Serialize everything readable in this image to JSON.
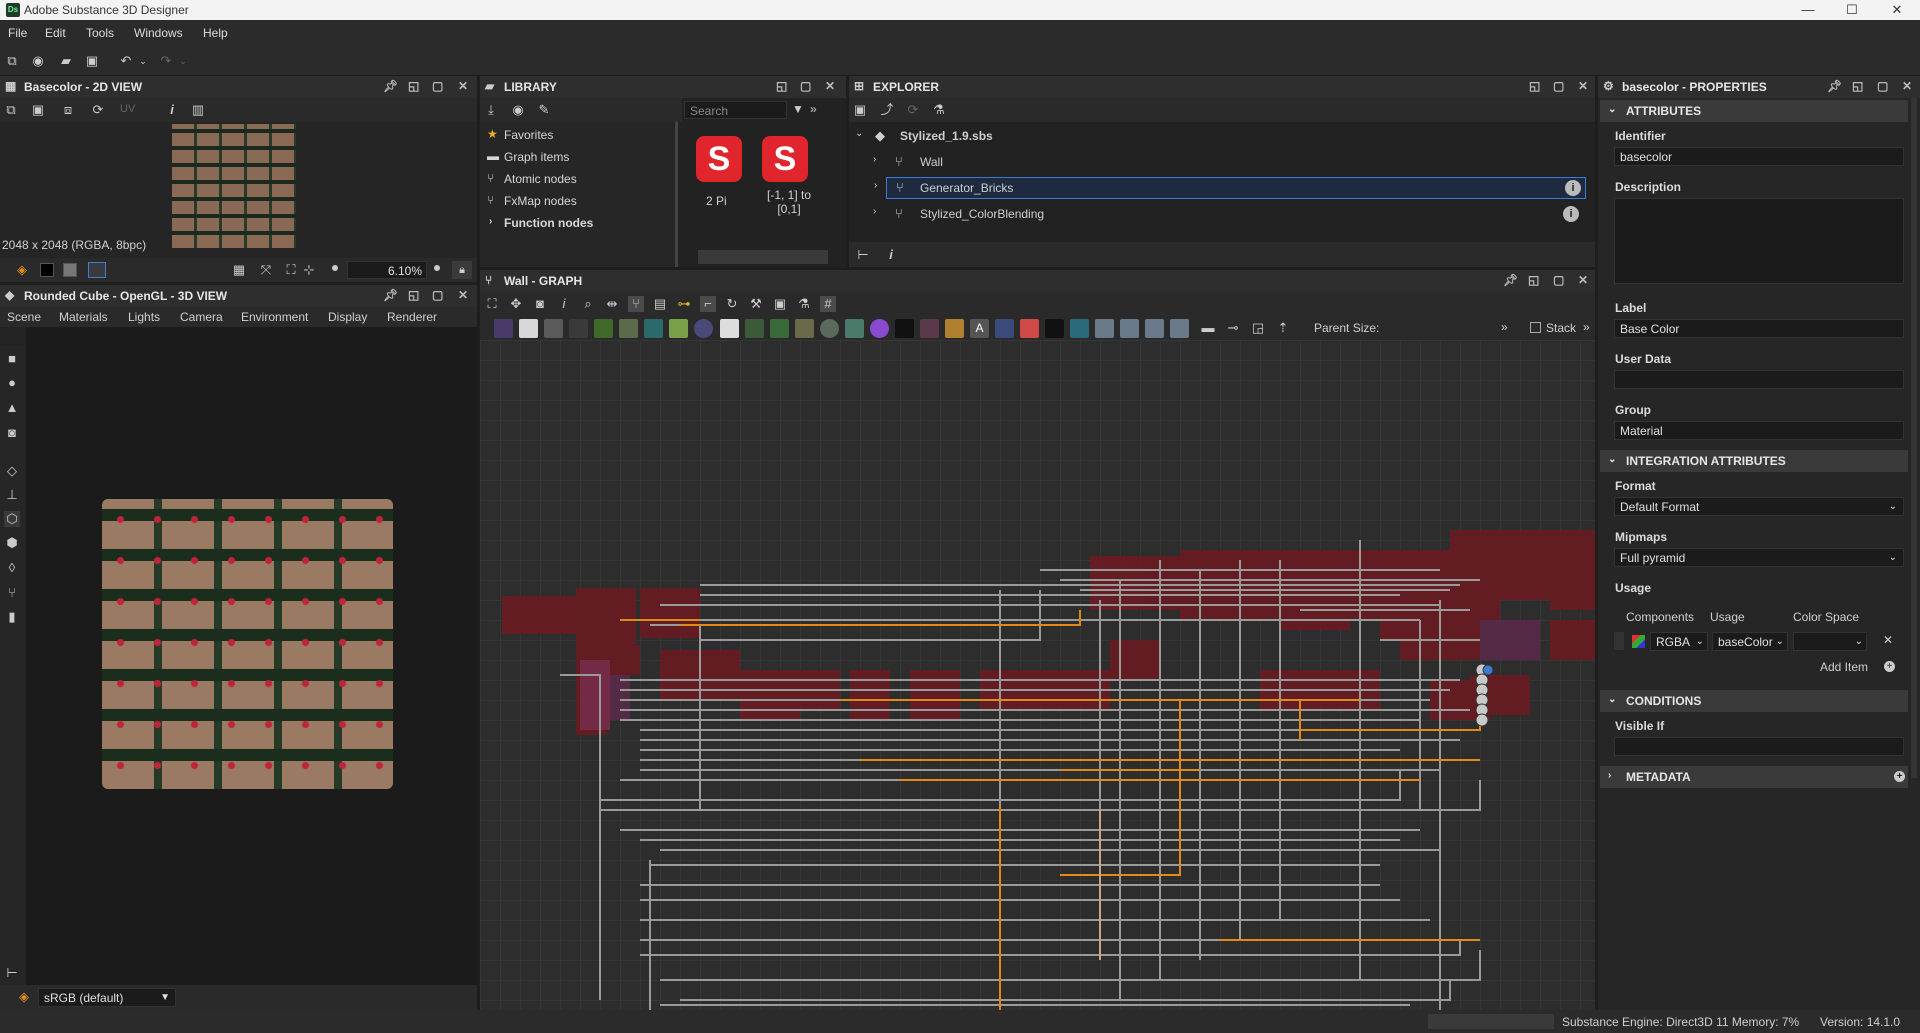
{
  "window": {
    "title": "Adobe Substance 3D Designer",
    "app_badge": "Ds",
    "controls": [
      "—",
      "☐",
      "✕"
    ]
  },
  "menu": [
    "File",
    "Edit",
    "Tools",
    "Windows",
    "Help"
  ],
  "view2d": {
    "title": "Basecolor - 2D VIEW",
    "uv_label": "UV",
    "image_info": "2048 x 2048 (RGBA, 8bpc)",
    "zoom": "6.10%"
  },
  "view3d": {
    "title": "Rounded Cube - OpenGL - 3D VIEW",
    "tabs": [
      "Scene",
      "Materials",
      "Lights",
      "Camera",
      "Environment",
      "Display",
      "Renderer"
    ],
    "colorspace": "sRGB (default)"
  },
  "library": {
    "title": "LIBRARY",
    "search_placeholder": "Search",
    "items": [
      {
        "label": "Favorites",
        "icon": "star-icon"
      },
      {
        "label": "Graph items",
        "icon": "comment-icon"
      },
      {
        "label": "Atomic nodes",
        "icon": "atomic-node-icon"
      },
      {
        "label": "FxMap nodes",
        "icon": "fxmap-icon"
      },
      {
        "label": "Function nodes",
        "icon": "chevron-right-icon"
      }
    ],
    "tiles": [
      {
        "label": "2 Pi"
      },
      {
        "label": "[-1, 1] to [0,1]"
      }
    ]
  },
  "explorer": {
    "title": "EXPLORER",
    "tree": [
      {
        "label": "Stylized_1.9.sbs",
        "level": 0
      },
      {
        "label": "Wall",
        "level": 1
      },
      {
        "label": "Generator_Bricks",
        "level": 1,
        "selected": true
      },
      {
        "label": "Stylized_ColorBlending",
        "level": 1
      }
    ]
  },
  "graph": {
    "title": "Wall - GRAPH",
    "parent_size_label": "Parent Size:",
    "stack_label": "Stack"
  },
  "properties": {
    "title": "basecolor - PROPERTIES",
    "sections": {
      "attributes": "ATTRIBUTES",
      "integration": "INTEGRATION ATTRIBUTES",
      "conditions": "CONDITIONS",
      "metadata": "METADATA"
    },
    "fields": {
      "identifier_label": "Identifier",
      "identifier_value": "basecolor",
      "description_label": "Description",
      "label_label": "Label",
      "label_value": "Base Color",
      "userdata_label": "User Data",
      "group_label": "Group",
      "group_value": "Material",
      "format_label": "Format",
      "format_value": "Default Format",
      "mipmaps_label": "Mipmaps",
      "mipmaps_value": "Full pyramid",
      "usage_label": "Usage",
      "components_header": "Components",
      "usage_header": "Usage",
      "colorspace_header": "Color Space",
      "components_value": "RGBA",
      "usage_value": "baseColor",
      "add_item": "Add Item",
      "visible_if_label": "Visible If"
    }
  },
  "status": {
    "engine": "Substance Engine: Direct3D 11  Memory: 7%",
    "version": "Version: 14.1.0"
  },
  "colors": {
    "accent_blue": "#3d7bd6",
    "node_red": "#7a1d22",
    "wire_gray": "#9a9a9a",
    "wire_orange": "#e08a1a",
    "brand_red": "#e0252c"
  }
}
